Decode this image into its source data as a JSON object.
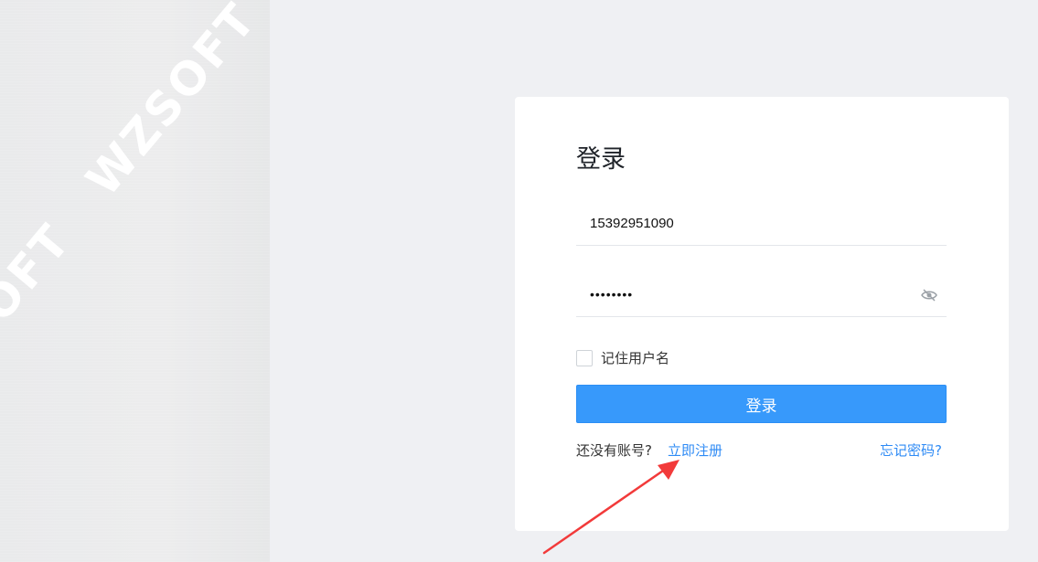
{
  "background": {
    "watermark_text": "WZSOFT",
    "watermark_partial": "WZSOFT"
  },
  "login_form": {
    "title": "登录",
    "username_value": "15392951090",
    "password_value": "••••••••",
    "remember_label": "记住用户名",
    "remember_checked": false,
    "submit_label": "登录",
    "no_account_text": "还没有账号?",
    "register_link": "立即注册",
    "forgot_link": "忘记密码?"
  },
  "colors": {
    "accent": "#3799fb",
    "link": "#2f8bf5",
    "annotation_arrow": "#f23a3a",
    "page_bg": "#eff0f3"
  },
  "icons": {
    "password_toggle": "eye-slash-icon"
  }
}
